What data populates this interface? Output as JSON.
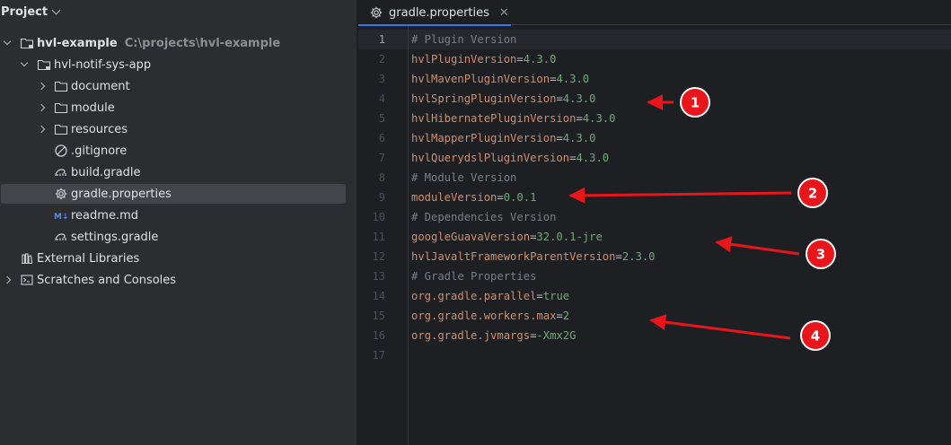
{
  "project_panel": {
    "title": "Project",
    "tree": [
      {
        "label": "hvl-example",
        "hint": "C:\\projects\\hvl-example",
        "icon": "folder-icon",
        "expanded": true,
        "level": 0
      },
      {
        "label": "hvl-notif-sys-app",
        "icon": "folder-icon",
        "expanded": true,
        "level": 1
      },
      {
        "label": "document",
        "icon": "folder-icon",
        "expanded": false,
        "level": 2
      },
      {
        "label": "module",
        "icon": "folder-icon",
        "expanded": false,
        "level": 2
      },
      {
        "label": "resources",
        "icon": "folder-icon",
        "expanded": false,
        "level": 2
      },
      {
        "label": ".gitignore",
        "icon": "gitignore-icon",
        "level": 2
      },
      {
        "label": "build.gradle",
        "icon": "gradle-icon",
        "level": 2
      },
      {
        "label": "gradle.properties",
        "icon": "gear-icon",
        "level": 2,
        "selected": true
      },
      {
        "label": "readme.md",
        "icon": "markdown-icon",
        "level": 2
      },
      {
        "label": "settings.gradle",
        "icon": "gradle-icon",
        "level": 2
      },
      {
        "label": "External Libraries",
        "icon": "library-icon",
        "level": 0
      },
      {
        "label": "Scratches and Consoles",
        "icon": "scratches-icon",
        "expanded": false,
        "level": 0
      }
    ]
  },
  "editor": {
    "tab": {
      "label": "gradle.properties",
      "close": "✕"
    },
    "lines": [
      {
        "n": "1",
        "comment": "# Plugin Version"
      },
      {
        "n": "2",
        "key": "hvlPluginVersion",
        "value": "4.3.0"
      },
      {
        "n": "3",
        "key": "hvlMavenPluginVersion",
        "value": "4.3.0"
      },
      {
        "n": "4",
        "key": "hvlSpringPluginVersion",
        "value": "4.3.0"
      },
      {
        "n": "5",
        "key": "hvlHibernatePluginVersion",
        "value": "4.3.0"
      },
      {
        "n": "6",
        "key": "hvlMapperPluginVersion",
        "value": "4.3.0"
      },
      {
        "n": "7",
        "key": "hvlQuerydslPluginVersion",
        "value": "4.3.0"
      },
      {
        "n": "8",
        "comment": "# Module Version"
      },
      {
        "n": "9",
        "key": "moduleVersion",
        "value": "0.0.1"
      },
      {
        "n": "10",
        "comment": "# Dependencies Version"
      },
      {
        "n": "11",
        "key": "googleGuavaVersion",
        "value": "32.0.1-jre"
      },
      {
        "n": "12",
        "key": "hvlJavaltFrameworkParentVersion",
        "value": "2.3.0"
      },
      {
        "n": "13",
        "comment": "# Gradle Properties"
      },
      {
        "n": "14",
        "key": "org.gradle.parallel",
        "value": "true"
      },
      {
        "n": "15",
        "key": "org.gradle.workers.max",
        "value": "2"
      },
      {
        "n": "16",
        "key": "org.gradle.jvmargs",
        "value": "-Xmx2G"
      },
      {
        "n": "17"
      }
    ]
  },
  "annotations": {
    "badges": [
      "1",
      "2",
      "3",
      "4"
    ],
    "color": "#e8161b"
  },
  "colors": {
    "panel_bg": "#2b2d30",
    "editor_bg": "#1e1f22",
    "selection": "#43454a",
    "accent": "#3574f0",
    "key": "#cf8e6d",
    "value": "#6aab73",
    "comment": "#7a7e85"
  }
}
